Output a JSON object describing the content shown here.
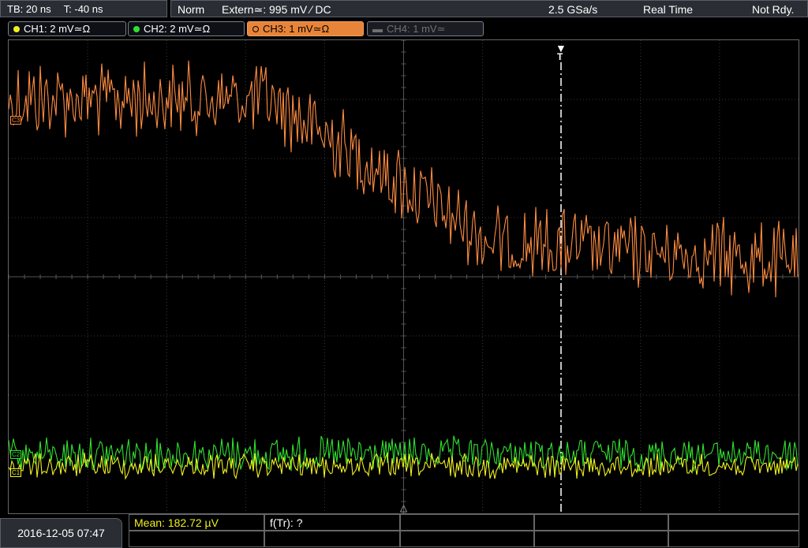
{
  "header": {
    "timebase": "TB: 20 ns",
    "trigger_time": "T: -40 ns",
    "mode": "Norm",
    "trigger_source": "Extern≃: 995 mV ⁄ DC",
    "sample_rate": "2.5 GSa/s",
    "acq_mode": "Real Time",
    "status": "Not Rdy."
  },
  "channels": [
    {
      "label": "CH1: 2 mV≃Ω",
      "color": "#f0f020",
      "state": "on"
    },
    {
      "label": "CH2: 2 mV≃Ω",
      "color": "#30e030",
      "state": "on"
    },
    {
      "label": "CH3: 1 mV≃Ω",
      "color": "#ff8c40",
      "state": "active"
    },
    {
      "label": "CH4: 1 mV≃",
      "color": "#707070",
      "state": "off"
    }
  ],
  "markers": {
    "ch3": "C3",
    "ch1": "C1",
    "ch2": "C2",
    "trigger": "T"
  },
  "footer": {
    "datetime": "2016-12-05 07:47",
    "mean": "Mean: 182.72 µV",
    "ftr": "f(Tr): ?"
  },
  "colors": {
    "ch1": "#f0f020",
    "ch2": "#30e030",
    "ch3": "#ff8c40",
    "grid": "#3a3a3a"
  },
  "chart_data": {
    "type": "line",
    "series": [
      {
        "name": "CH3",
        "level_start_div": 3.0,
        "level_end_div": 0.6,
        "noise_div": 0.55
      },
      {
        "name": "CH2",
        "level_div": -3.0,
        "noise_div": 0.25
      },
      {
        "name": "CH1",
        "level_div": -3.2,
        "noise_div": 0.18
      }
    ],
    "grid": true,
    "divisions_x": 10,
    "divisions_y": 8
  }
}
